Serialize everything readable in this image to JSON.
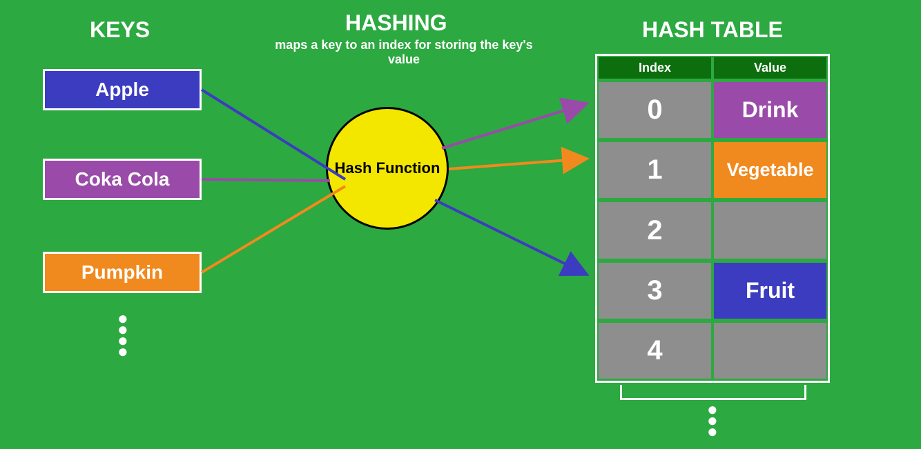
{
  "headings": {
    "keys": "KEYS",
    "hashing": "HASHING",
    "hashing_sub": "maps a key to an index for storing the key's value",
    "hash_table": "HASH TABLE"
  },
  "keys": [
    {
      "label": "Apple",
      "bg": "#3c3cc0"
    },
    {
      "label": "Coka Cola",
      "bg": "#9a4aa8"
    },
    {
      "label": "Pumpkin",
      "bg": "#f08a1e"
    }
  ],
  "hash_function_label": "Hash Function",
  "table": {
    "headers": {
      "index": "Index",
      "value": "Value"
    },
    "rows": [
      {
        "index": "0",
        "value": "Drink",
        "value_bg": "#9a4aa8"
      },
      {
        "index": "1",
        "value": "Vegetable",
        "value_bg": "#f08a1e"
      },
      {
        "index": "2",
        "value": "",
        "value_bg": ""
      },
      {
        "index": "3",
        "value": "Fruit",
        "value_bg": "#3c3cc0"
      },
      {
        "index": "4",
        "value": "",
        "value_bg": ""
      }
    ]
  },
  "mappings": [
    {
      "key": "Apple",
      "index": 3,
      "value": "Fruit"
    },
    {
      "key": "Coka Cola",
      "index": 0,
      "value": "Drink"
    },
    {
      "key": "Pumpkin",
      "index": 1,
      "value": "Vegetable"
    }
  ],
  "colors": {
    "bg": "#2ca940",
    "blue": "#3c3cc0",
    "purple": "#9a4aa8",
    "orange": "#f08a1e",
    "yellow": "#f3e700",
    "grey": "#8e8e8e",
    "dgreen": "#0d6e0d"
  }
}
